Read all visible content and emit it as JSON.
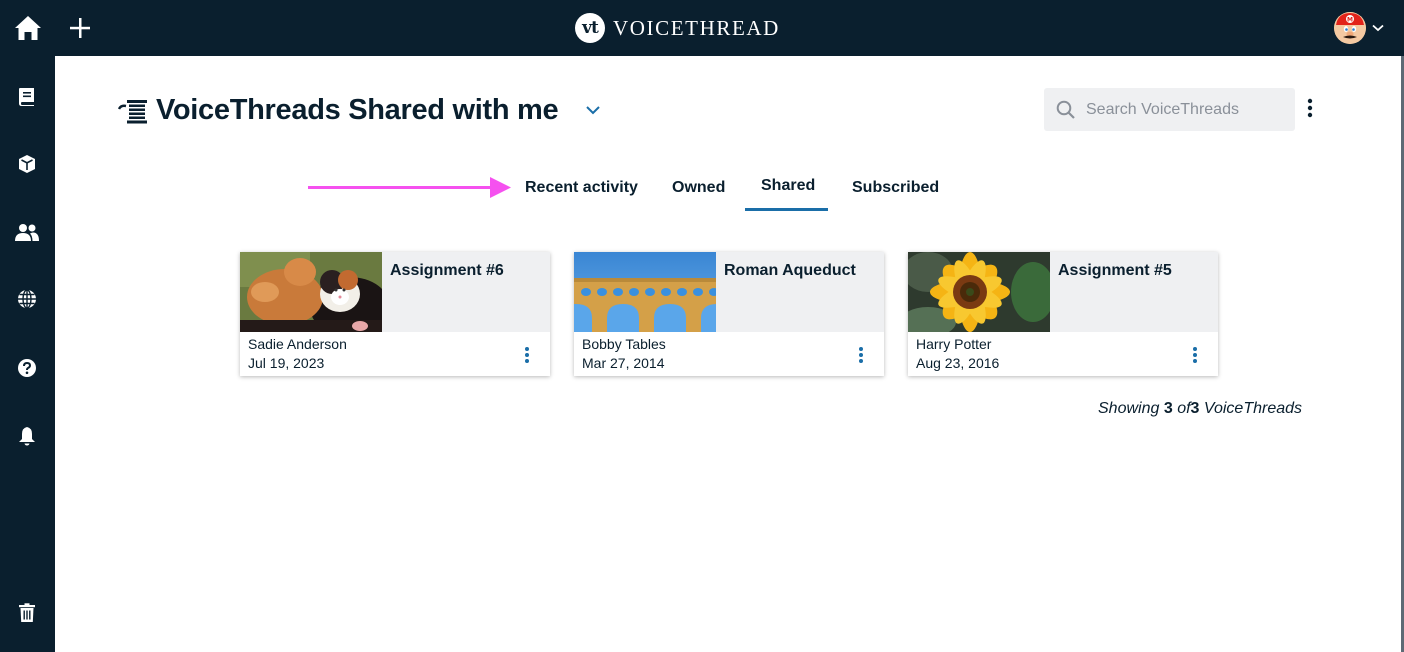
{
  "topbar": {
    "brand_mark": "vt",
    "brand_name": "VOICETHREAD",
    "home_label": "Home",
    "create_label": "Create",
    "account_label": "Account menu"
  },
  "sidebar": {
    "items": [
      {
        "name": "library",
        "icon": "book-icon"
      },
      {
        "name": "courses",
        "icon": "cube-icon"
      },
      {
        "name": "contacts",
        "icon": "users-icon"
      },
      {
        "name": "browse",
        "icon": "globe-icon"
      },
      {
        "name": "help",
        "icon": "help-icon"
      },
      {
        "name": "notifications",
        "icon": "bell-icon"
      },
      {
        "name": "trash",
        "icon": "trash-icon"
      }
    ]
  },
  "header": {
    "title": "VoiceThreads Shared with me",
    "search_placeholder": "Search VoiceThreads",
    "search_value": ""
  },
  "tabs": [
    {
      "label": "Recent activity",
      "active": false
    },
    {
      "label": "Owned",
      "active": false
    },
    {
      "label": "Shared",
      "active": true
    },
    {
      "label": "Subscribed",
      "active": false
    }
  ],
  "annotation": {
    "color": "#f551ef"
  },
  "cards": [
    {
      "title": "Assignment #6",
      "author": "Sadie Anderson",
      "date": "Jul 19, 2023",
      "thumbnail": "kittens"
    },
    {
      "title": "Roman Aqueduct",
      "author": "Bobby Tables",
      "date": "Mar 27, 2014",
      "thumbnail": "aqueduct"
    },
    {
      "title": "Assignment #5",
      "author": "Harry Potter",
      "date": "Aug 23, 2016",
      "thumbnail": "sunflower"
    }
  ],
  "footer": {
    "showing_prefix": "Showing",
    "shown": "3",
    "of": "of",
    "total": "3",
    "suffix": "VoiceThreads"
  },
  "colors": {
    "navy": "#0a1f2e",
    "accent": "#1a6ea8",
    "card_bg": "#eff0f2"
  }
}
